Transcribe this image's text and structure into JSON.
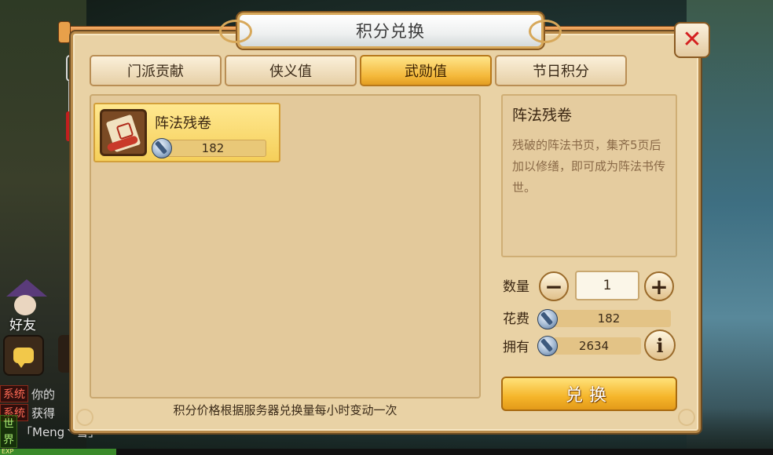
{
  "title": "积分兑换",
  "tabs": [
    {
      "label": "门派贡献",
      "active": false
    },
    {
      "label": "侠义值",
      "active": false
    },
    {
      "label": "武勋值",
      "active": true
    },
    {
      "label": "节日积分",
      "active": false
    }
  ],
  "items": [
    {
      "name": "阵法残卷",
      "price": "182"
    }
  ],
  "detail": {
    "name": "阵法残卷",
    "description": "残破的阵法书页，集齐5页后加以修缮，即可成为阵法书传世。"
  },
  "quantity": {
    "label": "数量",
    "value": "1"
  },
  "cost": {
    "label": "花费",
    "value": "182"
  },
  "owned": {
    "label": "拥有",
    "value": "2634"
  },
  "exchange_button": "兑换",
  "footer_note": "积分价格根据服务器兑换量每小时变动一次",
  "background": {
    "friend_label": "好友",
    "chat": [
      {
        "tag": "系统",
        "text": "你的"
      },
      {
        "tag": "系统",
        "text": "获得"
      },
      {
        "tag": "世界",
        "text": "「Meng丶雪」"
      }
    ],
    "exp_label": "EXP",
    "exp_progress": 0.15
  },
  "colors": {
    "accent": "#f4b83a",
    "panel": "#e9d2a5",
    "close": "#d42020"
  }
}
